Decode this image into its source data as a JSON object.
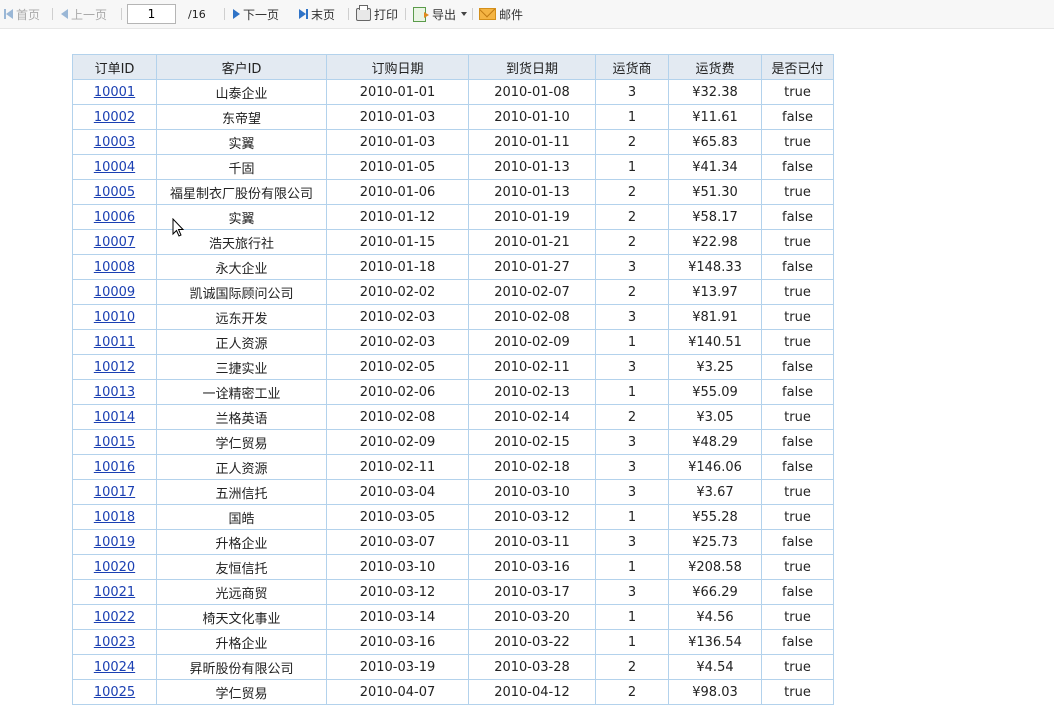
{
  "toolbar": {
    "first_label": "首页",
    "prev_label": "上一页",
    "page_value": "1",
    "page_total": "/16",
    "next_label": "下一页",
    "last_label": "末页",
    "print_label": "打印",
    "export_label": "导出",
    "mail_label": "邮件"
  },
  "table": {
    "headers": [
      "订单ID",
      "客户ID",
      "订购日期",
      "到货日期",
      "运货商",
      "运货费",
      "是否已付"
    ],
    "rows": [
      [
        "10001",
        "山泰企业",
        "2010-01-01",
        "2010-01-08",
        "3",
        "¥32.38",
        "true"
      ],
      [
        "10002",
        "东帝望",
        "2010-01-03",
        "2010-01-10",
        "1",
        "¥11.61",
        "false"
      ],
      [
        "10003",
        "实翼",
        "2010-01-03",
        "2010-01-11",
        "2",
        "¥65.83",
        "true"
      ],
      [
        "10004",
        "千固",
        "2010-01-05",
        "2010-01-13",
        "1",
        "¥41.34",
        "false"
      ],
      [
        "10005",
        "福星制衣厂股份有限公司",
        "2010-01-06",
        "2010-01-13",
        "2",
        "¥51.30",
        "true"
      ],
      [
        "10006",
        "实翼",
        "2010-01-12",
        "2010-01-19",
        "2",
        "¥58.17",
        "false"
      ],
      [
        "10007",
        "浩天旅行社",
        "2010-01-15",
        "2010-01-21",
        "2",
        "¥22.98",
        "true"
      ],
      [
        "10008",
        "永大企业",
        "2010-01-18",
        "2010-01-27",
        "3",
        "¥148.33",
        "false"
      ],
      [
        "10009",
        "凯诚国际顾问公司",
        "2010-02-02",
        "2010-02-07",
        "2",
        "¥13.97",
        "true"
      ],
      [
        "10010",
        "远东开发",
        "2010-02-03",
        "2010-02-08",
        "3",
        "¥81.91",
        "true"
      ],
      [
        "10011",
        "正人资源",
        "2010-02-03",
        "2010-02-09",
        "1",
        "¥140.51",
        "true"
      ],
      [
        "10012",
        "三捷实业",
        "2010-02-05",
        "2010-02-11",
        "3",
        "¥3.25",
        "false"
      ],
      [
        "10013",
        "一诠精密工业",
        "2010-02-06",
        "2010-02-13",
        "1",
        "¥55.09",
        "false"
      ],
      [
        "10014",
        "兰格英语",
        "2010-02-08",
        "2010-02-14",
        "2",
        "¥3.05",
        "true"
      ],
      [
        "10015",
        "学仁贸易",
        "2010-02-09",
        "2010-02-15",
        "3",
        "¥48.29",
        "false"
      ],
      [
        "10016",
        "正人资源",
        "2010-02-11",
        "2010-02-18",
        "3",
        "¥146.06",
        "false"
      ],
      [
        "10017",
        "五洲信托",
        "2010-03-04",
        "2010-03-10",
        "3",
        "¥3.67",
        "true"
      ],
      [
        "10018",
        "国皓",
        "2010-03-05",
        "2010-03-12",
        "1",
        "¥55.28",
        "true"
      ],
      [
        "10019",
        "升格企业",
        "2010-03-07",
        "2010-03-11",
        "3",
        "¥25.73",
        "false"
      ],
      [
        "10020",
        "友恒信托",
        "2010-03-10",
        "2010-03-16",
        "1",
        "¥208.58",
        "true"
      ],
      [
        "10021",
        "光远商贸",
        "2010-03-12",
        "2010-03-17",
        "3",
        "¥66.29",
        "false"
      ],
      [
        "10022",
        "椅天文化事业",
        "2010-03-14",
        "2010-03-20",
        "1",
        "¥4.56",
        "true"
      ],
      [
        "10023",
        "升格企业",
        "2010-03-16",
        "2010-03-22",
        "1",
        "¥136.54",
        "false"
      ],
      [
        "10024",
        "昇昕股份有限公司",
        "2010-03-19",
        "2010-03-28",
        "2",
        "¥4.54",
        "true"
      ],
      [
        "10025",
        "学仁贸易",
        "2010-04-07",
        "2010-04-12",
        "2",
        "¥98.03",
        "true"
      ]
    ]
  }
}
